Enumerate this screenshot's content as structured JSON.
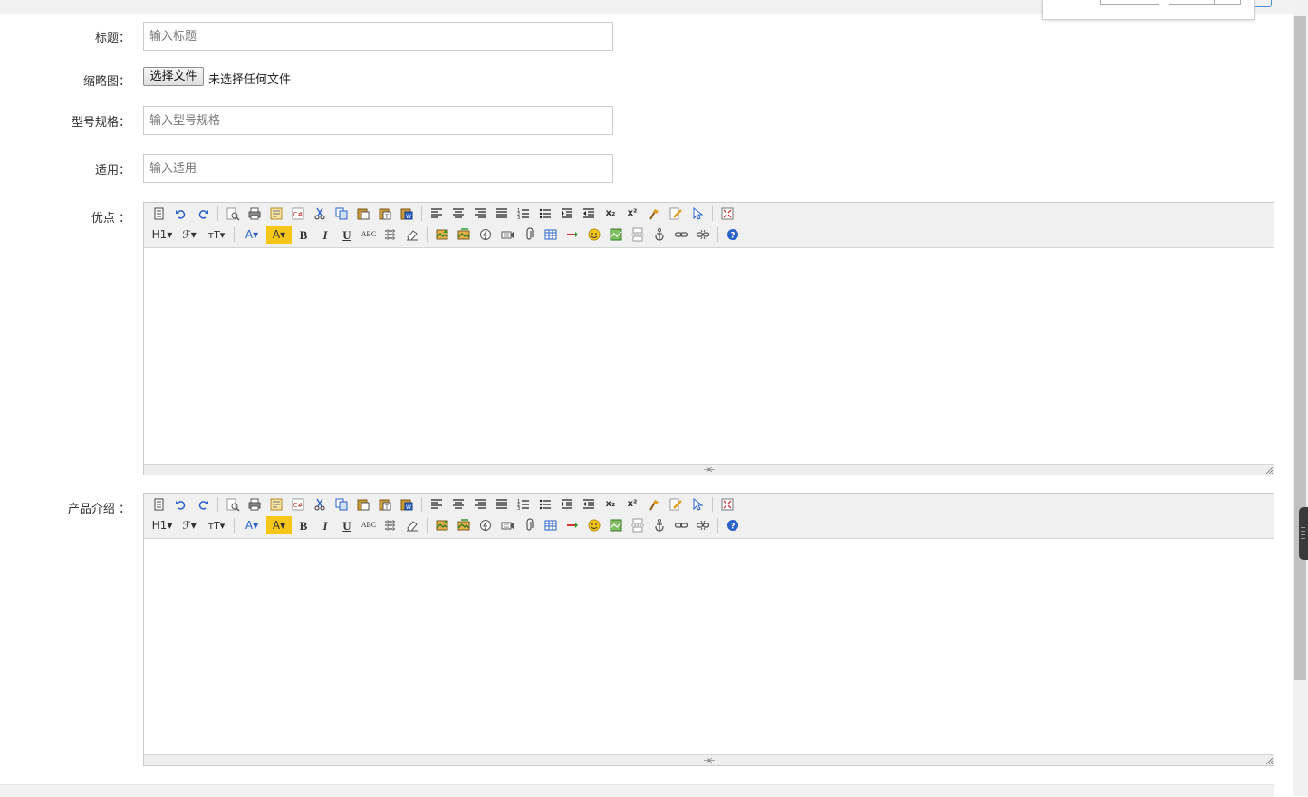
{
  "form": {
    "title_label": "标题：",
    "title_placeholder": "输入标题",
    "thumb_label": "缩略图：",
    "file_button": "选择文件",
    "file_status": "未选择任何文件",
    "model_label": "型号规格：",
    "model_placeholder": "输入型号规格",
    "apply_label": "适用：",
    "apply_placeholder": "输入适用",
    "advantage_label": "优点 ：",
    "intro_label": "产品介绍 ："
  },
  "toolbar": {
    "row1": [
      "source",
      "undo",
      "redo",
      "|",
      "preview",
      "print",
      "template",
      "code",
      "cut",
      "copy",
      "paste",
      "paste-plain",
      "paste-word",
      "|",
      "align-left",
      "align-center",
      "align-right",
      "align-justify",
      "ordered-list",
      "unordered-list",
      "indent",
      "outdent",
      "subscript",
      "superscript",
      "clear-format",
      "quick-format",
      "select-all",
      "|",
      "fullscreen"
    ],
    "row2": [
      "heading",
      "font-family",
      "font-size",
      "|",
      "font-color",
      "highlight",
      "bold",
      "italic",
      "underline",
      "strikethrough",
      "line-height",
      "remove-format",
      "|",
      "image",
      "multi-image",
      "flash",
      "media",
      "attachment",
      "table",
      "hr",
      "emoticon",
      "map",
      "pagebreak",
      "anchor",
      "link",
      "unlink",
      "|",
      "about"
    ],
    "glyphs": {
      "heading": "H1▾",
      "font-family": "ℱ▾",
      "font-size": "тT▾",
      "font-color": "A▾",
      "highlight": "A▾",
      "bold": "B",
      "italic": "I",
      "underline": "U",
      "strikethrough": "ABC",
      "subscript": "x₂",
      "superscript": "x²"
    }
  }
}
